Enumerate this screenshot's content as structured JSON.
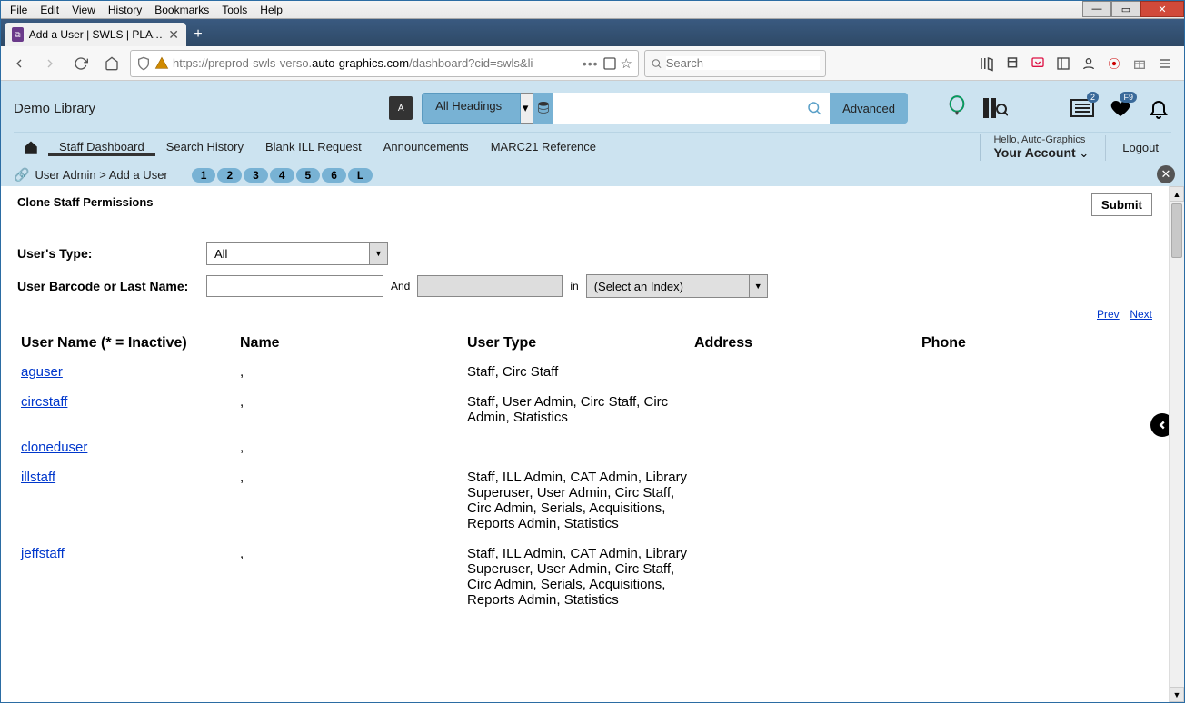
{
  "browser": {
    "menu": [
      "File",
      "Edit",
      "View",
      "History",
      "Bookmarks",
      "Tools",
      "Help"
    ],
    "tab_title": "Add a User | SWLS | PLATT | Au…",
    "url_secure_part1": "https://preprod-swls-verso.",
    "url_secure_domain": "auto-graphics.com",
    "url_secure_part2": "/dashboard?cid=swls&li",
    "search_placeholder": "Search"
  },
  "app": {
    "brand": "Demo Library",
    "headings": "All Headings",
    "advanced": "Advanced",
    "badge_list": "2",
    "badge_heart": "F9",
    "greeting": "Hello, Auto-Graphics",
    "your_account": "Your Account",
    "logout": "Logout",
    "nav": [
      "Staff Dashboard",
      "Search History",
      "Blank ILL Request",
      "Announcements",
      "MARC21 Reference"
    ]
  },
  "crumb": {
    "path": "User Admin > Add a User",
    "pages": [
      "1",
      "2",
      "3",
      "4",
      "5",
      "6",
      "L"
    ]
  },
  "page": {
    "title": "Clone Staff Permissions",
    "submit": "Submit",
    "users_type_label": "User's Type:",
    "users_type_value": "All",
    "barcode_label": "User Barcode or Last Name:",
    "and": "And",
    "in": "in",
    "index_placeholder": "(Select an Index)",
    "prev": "Prev",
    "next": "Next",
    "columns": {
      "uname": "User Name (* = Inactive)",
      "name": "Name",
      "utype": "User Type",
      "addr": "Address",
      "phone": "Phone"
    },
    "rows": [
      {
        "uname": "aguser",
        "name": ",",
        "utype": "Staff, Circ Staff",
        "addr": "",
        "phone": ""
      },
      {
        "uname": "circstaff",
        "name": ",",
        "utype": "Staff, User Admin, Circ Staff, Circ Admin, Statistics",
        "addr": "",
        "phone": ""
      },
      {
        "uname": "cloneduser",
        "name": ",",
        "utype": "",
        "addr": "",
        "phone": ""
      },
      {
        "uname": "illstaff",
        "name": ",",
        "utype": "Staff, ILL Admin, CAT Admin, Library Superuser, User Admin, Circ Staff, Circ Admin, Serials, Acquisitions, Reports Admin, Statistics",
        "addr": "",
        "phone": ""
      },
      {
        "uname": "jeffstaff",
        "name": ",",
        "utype": "Staff, ILL Admin, CAT Admin, Library Superuser, User Admin, Circ Staff, Circ Admin, Serials, Acquisitions, Reports Admin, Statistics",
        "addr": "",
        "phone": ""
      }
    ]
  }
}
